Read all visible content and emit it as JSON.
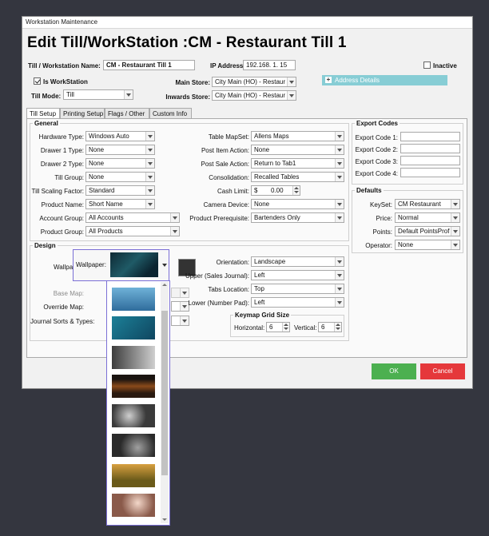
{
  "window": {
    "title": "Workstation Maintenance",
    "heading": "Edit Till/WorkStation :CM - Restaurant Till 1"
  },
  "top": {
    "till_label": "Till / Workstation Name:",
    "till_value": "CM - Restaurant Till 1",
    "ip_label": "IP Address:",
    "ip_value": "192.168.  1. 15",
    "inactive_label": "Inactive",
    "is_workstation_label": "Is WorkStation",
    "main_store_label": "Main Store:",
    "main_store_value": "City Main (HO) - Restaur",
    "till_mode_label": "Till Mode:",
    "till_mode_value": "Till",
    "inwards_store_label": "Inwards Store:",
    "inwards_store_value": "City Main (HO) - Restaur",
    "address_details": "Address Details"
  },
  "tabs": [
    "Till Setup",
    "Printing Setup",
    "Flags / Other",
    "Custom Info"
  ],
  "general": {
    "title": "General",
    "left": [
      {
        "label": "Hardware Type:",
        "value": "Windows Auto"
      },
      {
        "label": "Drawer 1 Type:",
        "value": "None"
      },
      {
        "label": "Drawer 2 Type:",
        "value": "None"
      },
      {
        "label": "Till Group:",
        "value": "None"
      },
      {
        "label": "Till Scaling Factor:",
        "value": "Standard"
      },
      {
        "label": "Product Name:",
        "value": "Short Name"
      },
      {
        "label": "Account Group:",
        "value": "All Accounts"
      },
      {
        "label": "Product Group:",
        "value": "All Products"
      }
    ],
    "right": [
      {
        "label": "Table MapSet:",
        "value": "Allens Maps"
      },
      {
        "label": "Post Item Action:",
        "value": "None"
      },
      {
        "label": "Post Sale Action:",
        "value": "Return to Tab1"
      },
      {
        "label": "Consolidation:",
        "value": "Recalled Tables"
      },
      {
        "label": "Cash Limit:",
        "value": "0.00",
        "prefix": "$"
      },
      {
        "label": "Camera Device:",
        "value": "None"
      },
      {
        "label": "Product Prerequisite:",
        "value": "Bartenders Only"
      }
    ]
  },
  "export": {
    "title": "Export Codes",
    "codes": [
      "Export Code 1:",
      "Export Code 2:",
      "Export Code 3:",
      "Export Code 4:"
    ]
  },
  "defaults": {
    "title": "Defaults",
    "rows": [
      {
        "label": "KeySet:",
        "value": "CM Restaurant"
      },
      {
        "label": "Price:",
        "value": "Normal"
      },
      {
        "label": "Points:",
        "value": "Default PointsProf"
      },
      {
        "label": "Operator:",
        "value": "None"
      }
    ]
  },
  "design": {
    "title": "Design",
    "wallpaper_label": "Wallpaper:",
    "base_map_label": "Base Map:",
    "override_map_label": "Override Map:",
    "journal_label": "Journal Sorts & Types:",
    "orientation_label": "Orientation:",
    "orientation_value": "Landscape",
    "upper_label": "Upper (Sales Journal):",
    "upper_value": "Left",
    "tabs_location_label": "Tabs Location:",
    "tabs_location_value": "Top",
    "lower_label": "Lower (Number Pad):",
    "lower_value": "Left",
    "grid_title": "Keymap Grid Size",
    "horizontal_label": "Horizontal:",
    "horizontal_value": "6",
    "vertical_label": "Vertical:",
    "vertical_value": "6"
  },
  "buttons": {
    "ok": "OK",
    "cancel": "Cancel"
  },
  "colors": {
    "ok": "#4cb050",
    "cancel": "#e5383b",
    "address_bar": "#87cdd5",
    "highlight": "#7b6fd6",
    "page_bg": "#34363f"
  }
}
